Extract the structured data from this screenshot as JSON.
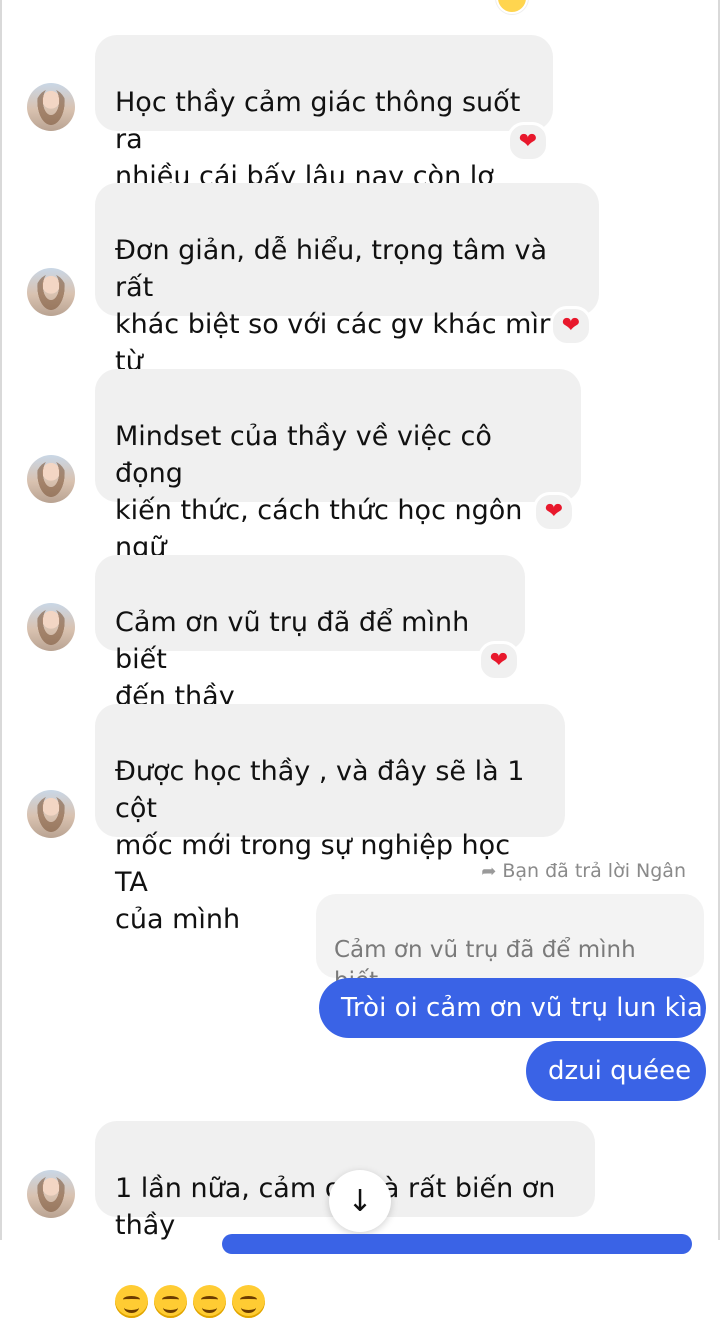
{
  "messages": [
    {
      "text": "Học thầy cảm giác thông suốt ra\nnhiều cái bấy lâu nay còn lơ mơ ạ",
      "reaction": "❤"
    },
    {
      "text": "Đơn giản, dễ hiểu, trọng tâm và rất\nkhác biệt so với các gv khác mình từ\nhọc",
      "reaction": "❤"
    },
    {
      "text": "Mindset của thầy về việc cô đọng\nkiến thức, cách thức học ngôn ngữ\nquá đỉnh",
      "reaction": "❤"
    },
    {
      "text": "Cảm ơn vũ trụ đã để mình biết\nđến thầy",
      "reaction": "❤"
    },
    {
      "text": "Được học thầy , và đây sẽ là 1 cột\nmốc mới trong sự nghiệp học TA\ncủa mình"
    },
    {
      "text": "1 lần nữa, cảm ơn và rất biến ơn thầy"
    }
  ],
  "reply": {
    "label": "Bạn đã trả lời Ngân",
    "quoted": "Cảm ơn vũ trụ đã để mình biết\nđến thầy"
  },
  "sent": [
    "Tròi oi cảm ơn vũ trụ lun kìa",
    "dzui quéee"
  ],
  "scroll_button": "↓",
  "colors": {
    "sent_bubble": "#3a63e6",
    "received_bubble": "#f0f0f0",
    "heart": "#e8182c"
  }
}
